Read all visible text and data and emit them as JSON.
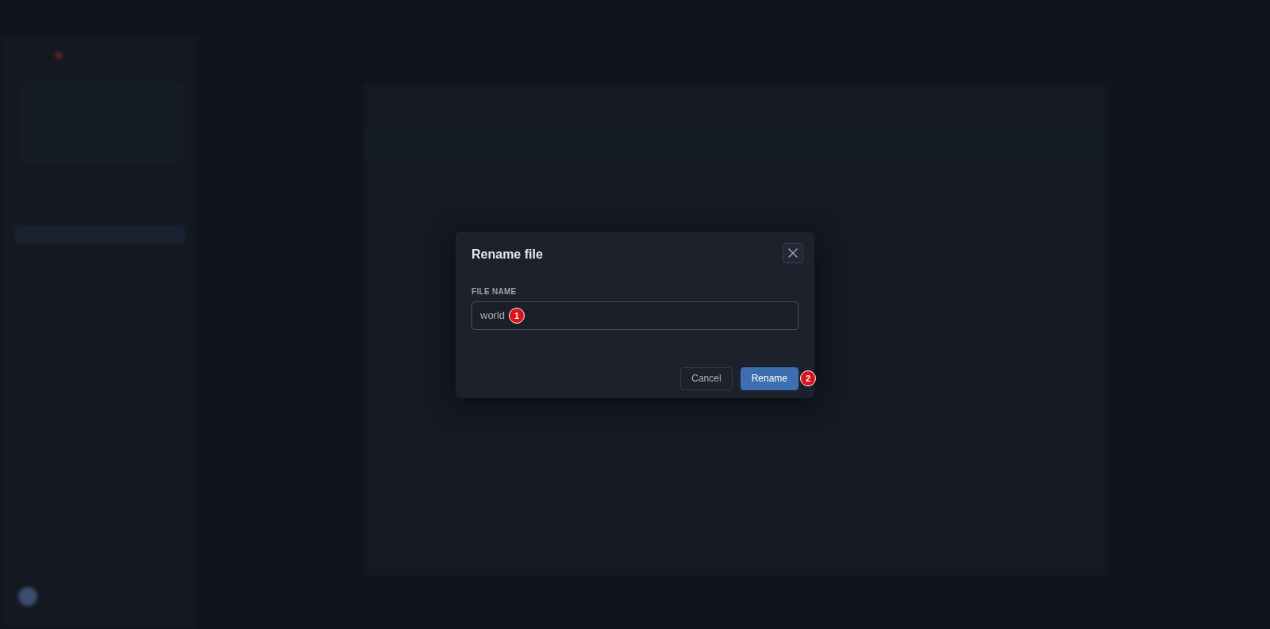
{
  "dialog": {
    "title": "Rename file",
    "field": {
      "label": "FILE NAME",
      "value": "world",
      "marker": "1"
    },
    "buttons": [
      {
        "label": "Cancel",
        "kind": "secondary"
      },
      {
        "label": "Rename",
        "kind": "primary",
        "marker": "2"
      }
    ]
  }
}
